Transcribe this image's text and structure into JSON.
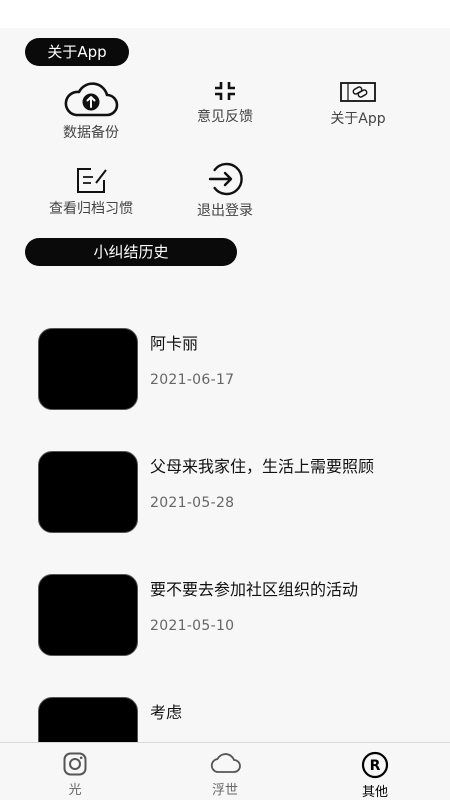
{
  "section_about": {
    "label": "关于App"
  },
  "grid": {
    "backup": "数据备份",
    "feedback": "意见反馈",
    "about": "关于App",
    "archive": "查看归档习惯",
    "logout": "退出登录"
  },
  "section_history": {
    "label": "小纠结历史"
  },
  "history": [
    {
      "title": "阿卡丽",
      "date": "2021-06-17"
    },
    {
      "title": "父母来我家住，生活上需要照顾",
      "date": "2021-05-28"
    },
    {
      "title": "要不要去参加社区组织的活动",
      "date": "2021-05-10"
    },
    {
      "title": "考虑",
      "date": ""
    }
  ],
  "nav": {
    "light": "光",
    "floating": "浮世",
    "other": "其他",
    "active": "other"
  },
  "icons": {
    "backup": "cloud-upload-icon",
    "feedback": "collapse-arrows-icon",
    "about": "ticket-link-icon",
    "archive": "edit-note-icon",
    "logout": "sign-out-icon",
    "light": "instagram-icon",
    "floating": "cloud-icon",
    "other": "registered-icon"
  }
}
